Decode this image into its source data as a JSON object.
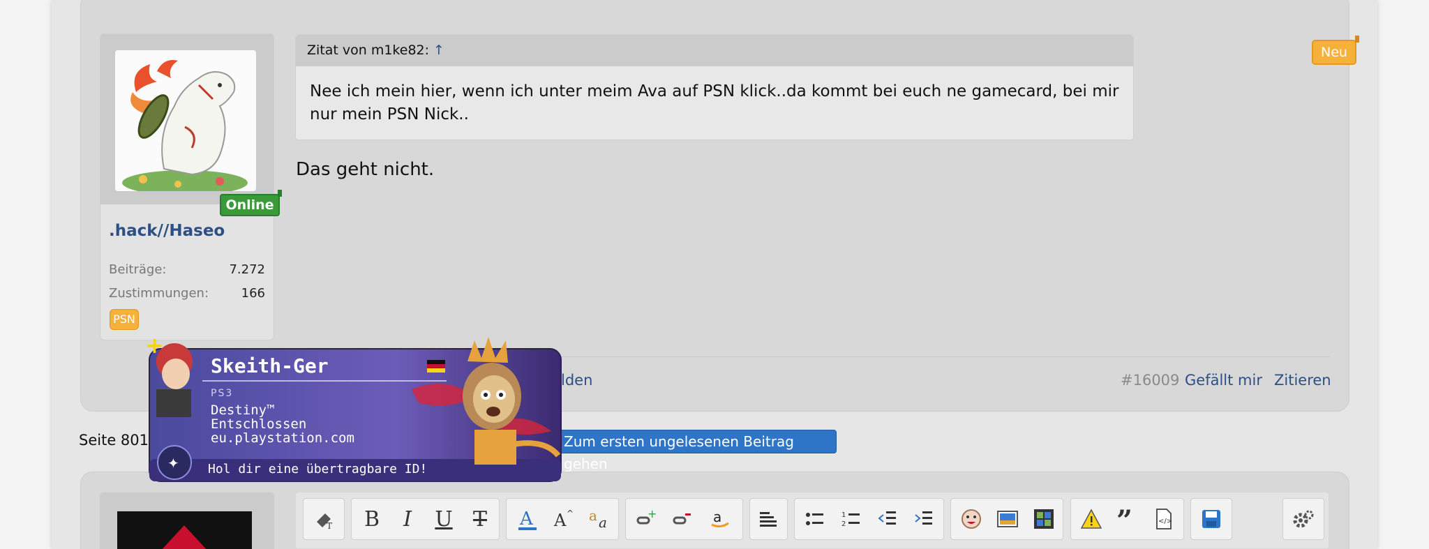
{
  "post": {
    "new_badge": "Neu",
    "user": {
      "name": ".hack//Haseo",
      "status": "Online",
      "stats": [
        {
          "label": "Beiträge:",
          "value": "7.272"
        },
        {
          "label": "Zustimmungen:",
          "value": "166"
        }
      ],
      "badge": "PSN"
    },
    "quote": {
      "header": "Zitat von m1ke82:",
      "arrow": "↑",
      "text": "Nee ich mein hier, wenn ich unter meim Ava auf PSN klick..da kommt bei euch ne gamecard, bei mir nur mein PSN Nick.."
    },
    "message": "Das geht nicht.",
    "footer": {
      "report_fragment": "lden",
      "post_number": "#16009",
      "like": "Gefällt mir",
      "quote": "Zitieren"
    }
  },
  "psn_card": {
    "name": "Skeith-Ger",
    "platform": "PS3",
    "game": "Destiny™",
    "mood": "Entschlossen",
    "site": "eu.playstation.com",
    "footer": "Hol dir eine übertragbare ID!"
  },
  "pagination": {
    "label": "Seite 801 v",
    "unread_button": "Zum ersten ungelesenen Beitrag gehen"
  },
  "editor": {
    "toolbar": [
      "remove-format",
      "bold",
      "italic",
      "underline",
      "strikethrough",
      "font-color",
      "font-size",
      "font-family",
      "insert-link",
      "remove-link",
      "amazon",
      "align",
      "bullet-list",
      "numbered-list",
      "outdent",
      "indent",
      "smilies",
      "image",
      "media",
      "spoiler",
      "quote",
      "code",
      "save-draft",
      "settings"
    ],
    "labels": {
      "bold": "B",
      "italic": "I",
      "underline": "U",
      "strike": "T"
    }
  },
  "colors": {
    "link": "#2c4f85",
    "online": "#3a9a3a",
    "badge": "#f6b13a",
    "button": "#2e74c7"
  }
}
